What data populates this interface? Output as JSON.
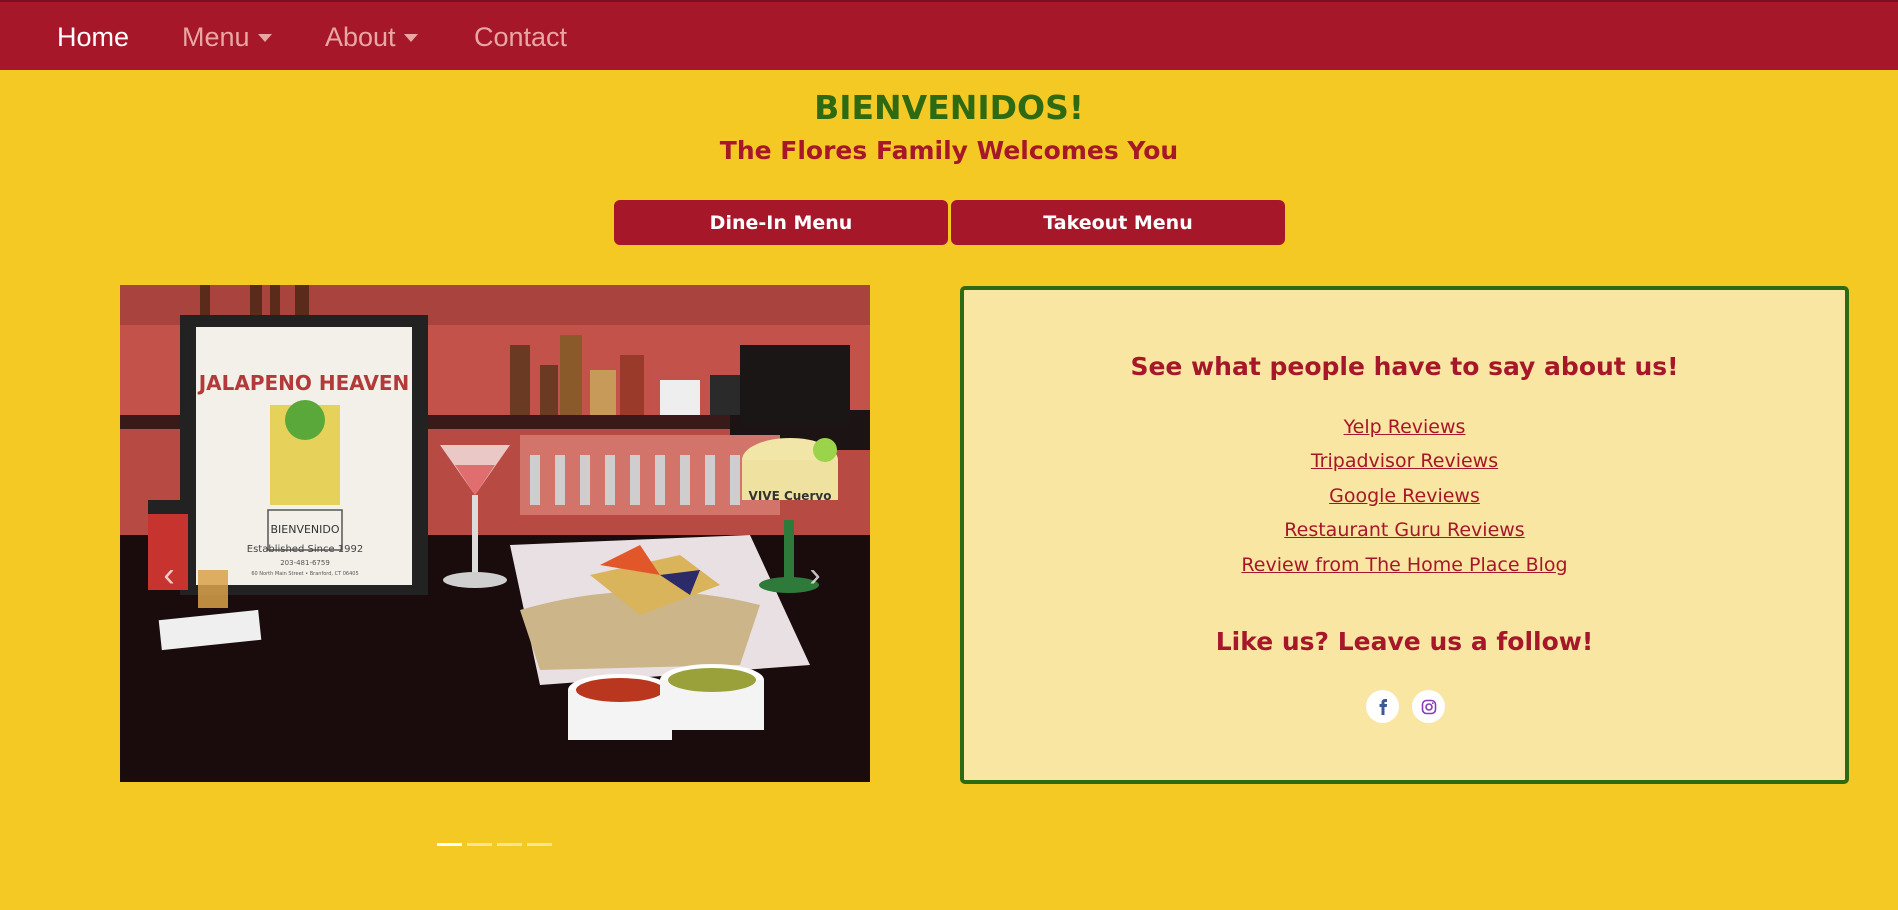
{
  "nav": {
    "items": [
      {
        "label": "Home",
        "active": true
      },
      {
        "label": "Menu",
        "dropdown": true
      },
      {
        "label": "About",
        "dropdown": true
      },
      {
        "label": "Contact"
      }
    ]
  },
  "hero": {
    "title": "BIENVENIDOS!",
    "subtitle": "The Flores Family Welcomes You"
  },
  "buttons": {
    "dine_in": "Dine-In Menu",
    "takeout": "Takeout Menu"
  },
  "carousel": {
    "slide_count": 4,
    "active_index": 0,
    "menu_card": {
      "title": "JALAPENO HEAVEN",
      "caption": "BIENVENIDO",
      "established": "Established Since 1992",
      "phone": "203-481-6759",
      "address": "60 North Main Street • Branford, CT 06405"
    },
    "glass_brand": "VIVE Cuervo"
  },
  "reviews": {
    "title": "See what people have to say about us!",
    "links": [
      "Yelp Reviews",
      "Tripadvisor Reviews",
      "Google Reviews",
      "Restaurant Guru Reviews",
      "Review from The Home Place Blog"
    ],
    "follow_title": "Like us? Leave us a follow!",
    "social": [
      {
        "icon": "facebook-icon",
        "color": "#3b5998"
      },
      {
        "icon": "instagram-icon",
        "color": "#8a3ab9"
      }
    ]
  },
  "colors": {
    "background": "#f5c923",
    "brand_red": "#a6172a",
    "brand_green": "#2e6a12",
    "panel": "#f9e6a3"
  }
}
